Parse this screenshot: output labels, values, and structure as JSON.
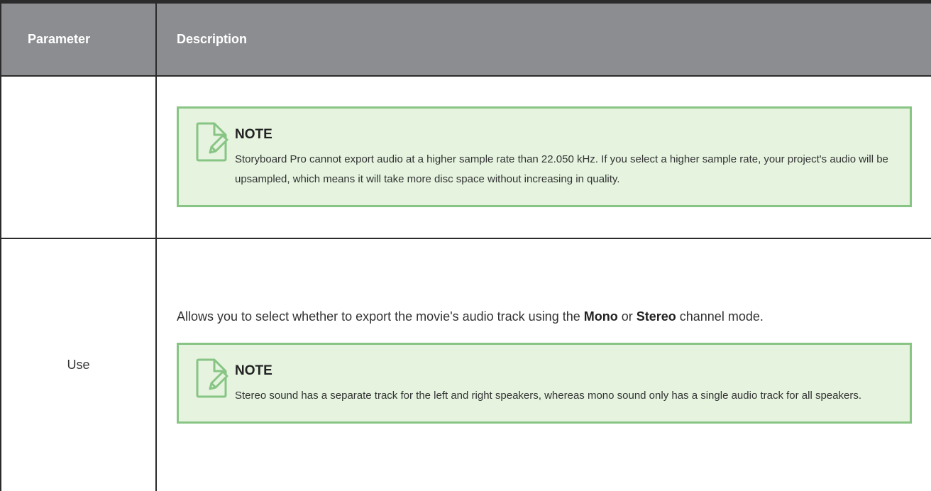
{
  "table": {
    "headers": {
      "parameter": "Parameter",
      "description": "Description"
    },
    "rows": [
      {
        "parameter": "",
        "note": {
          "icon": "note-pencil-icon",
          "title": "NOTE",
          "text": "Storyboard Pro cannot export audio at a higher sample rate than 22.050 kHz. If you select a higher sample rate, your project's audio will be upsampled, which means it will take more disc space without increasing in quality."
        }
      },
      {
        "parameter": "Use",
        "description": {
          "part1": "Allows you to select whether to export the movie's audio track using the ",
          "bold1": "Mono",
          "part2": " or ",
          "bold2": "Stereo",
          "part3": " channel mode."
        },
        "note": {
          "icon": "note-pencil-icon",
          "title": "NOTE",
          "text": "Stereo sound has a separate track for the left and right speakers, whereas mono sound only has a single audio track for all speakers."
        }
      }
    ]
  },
  "colors": {
    "header_bg": "#8c8d91",
    "note_bg": "#e5f3df",
    "note_border": "#88c585",
    "border": "#2b2b2b"
  }
}
